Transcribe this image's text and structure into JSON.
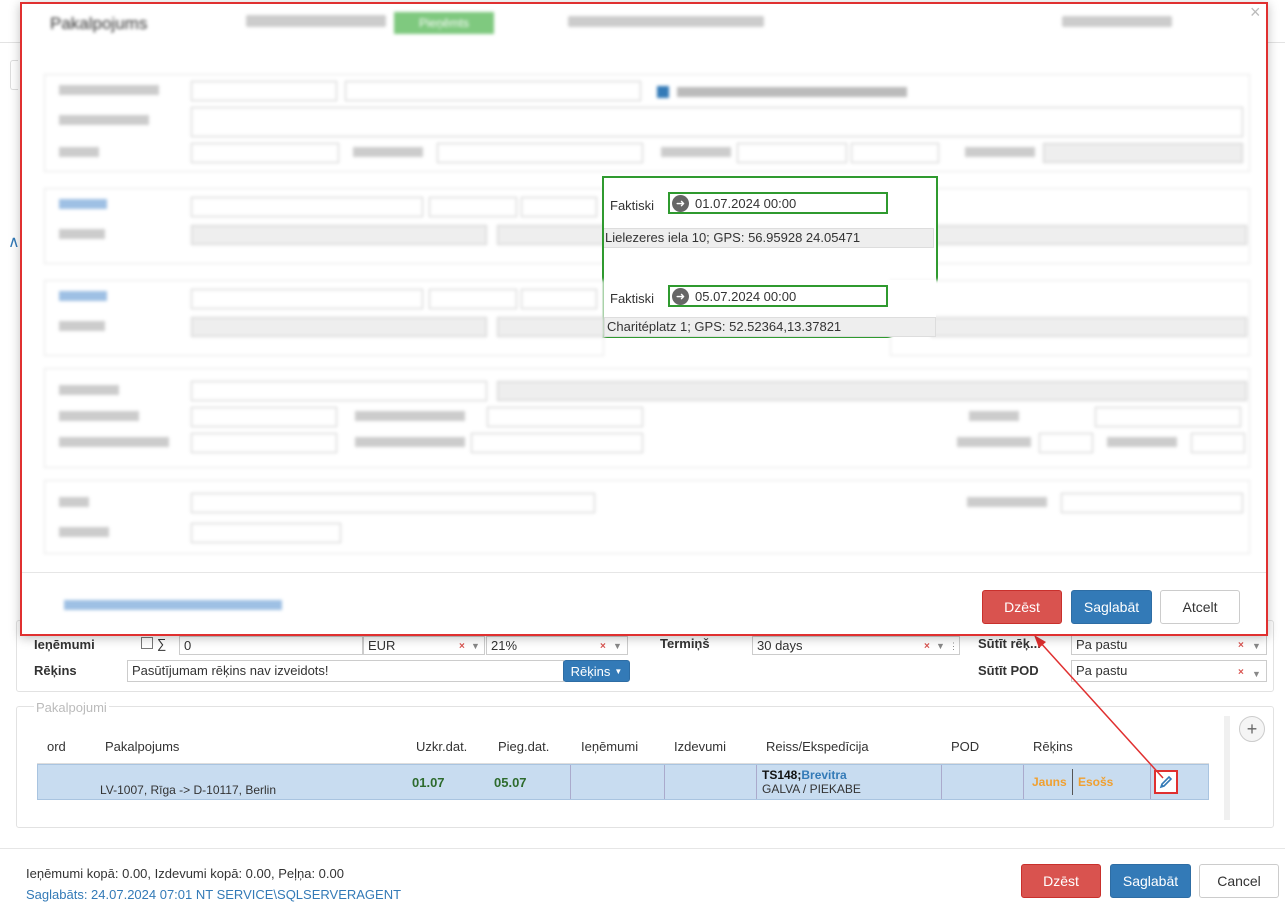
{
  "modal": {
    "title": "Pakalpojums",
    "status_badge": "Pieņēmts",
    "faktiski_label": "Faktiski",
    "pickup_actual": "01.07.2024 00:00",
    "pickup_address_visible": "Lielezeres iela 10; GPS: 56.95928 24.05471",
    "delivery_actual": "05.07.2024 00:00",
    "delivery_address_visible": "Charitéplatz 1; GPS: 52.52364,13.37821",
    "buttons": {
      "delete": "Dzēst",
      "save": "Saglabāt",
      "cancel": "Atcelt"
    },
    "close_glyph": "×"
  },
  "background": {
    "income": {
      "label": "Ieņēmumi",
      "sum_glyph": "∑",
      "value": "0",
      "currency": "EUR",
      "vat": "21%"
    },
    "terms": {
      "label": "Termiņš",
      "value": "30 days"
    },
    "send_invoice": {
      "label": "Sūtīt rēķ...",
      "value": "Pa pastu"
    },
    "send_pod": {
      "label": "Sūtīt POD",
      "value": "Pa pastu"
    },
    "invoice": {
      "label": "Rēķins",
      "value": "Pasūtījumam rēķins nav izveidots!",
      "button": "Rēķins"
    },
    "services": {
      "legend": "Pakalpojumi",
      "columns": [
        "ord",
        "Pakalpojums",
        "Uzkr.dat.",
        "Pieg.dat.",
        "Ieņēmumi",
        "Izdevumi",
        "Reiss/Ekspedīcija",
        "POD",
        "Rēķins"
      ],
      "row": {
        "ord": "",
        "service": "LV-1007, Rīga -> D-10117, Berlin",
        "load_date": "01.07",
        "delivery_date": "05.07",
        "income": "",
        "expenses": "",
        "trip_code": "TS148",
        "trip_separator": ";",
        "trip_carrier": "Brevitra",
        "trip_vehicle": "GALVA / PIEKABE",
        "pod": "",
        "invoice_status_1": "Jauns",
        "invoice_status_2": "Esošs"
      }
    },
    "footer": {
      "totals": "Ieņēmumi kopā: 0.00, Izdevumi kopā: 0.00, Peļņa: 0.00",
      "saved": "Saglabāts: 24.07.2024 07:01 NT SERVICE\\SQLSERVERAGENT",
      "buttons": {
        "delete": "Dzēst",
        "save": "Saglabāt",
        "cancel": "Cancel"
      }
    }
  },
  "colors": {
    "accent": "#337ab7",
    "danger": "#d9534f",
    "highlight_green": "#2f9a2f",
    "annotation_red": "#e03030"
  }
}
